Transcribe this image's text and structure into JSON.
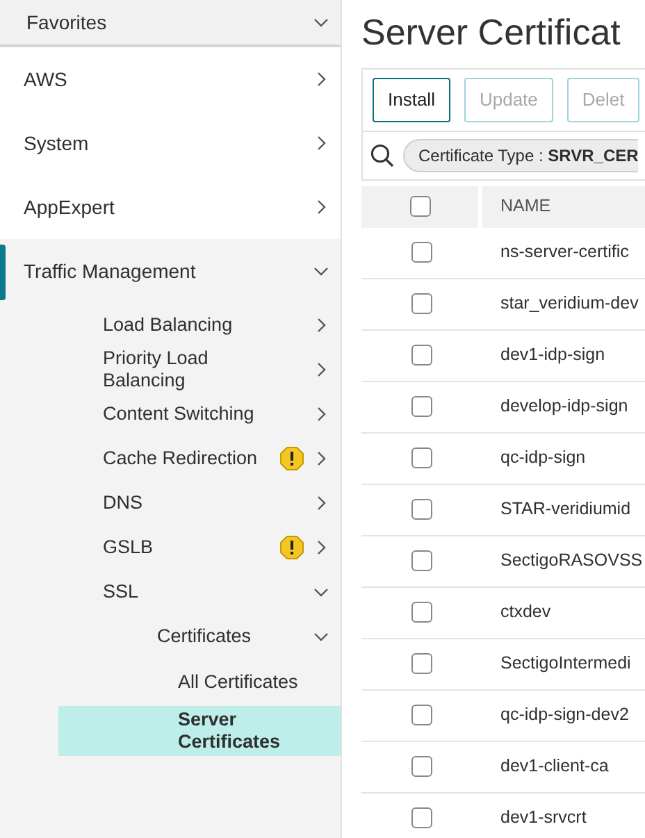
{
  "sidebar": {
    "favorites": {
      "label": "Favorites",
      "expanded": true
    },
    "items": [
      {
        "label": "AWS",
        "expanded": false,
        "active": false
      },
      {
        "label": "System",
        "expanded": false,
        "active": false
      },
      {
        "label": "AppExpert",
        "expanded": false,
        "active": false
      },
      {
        "label": "Traffic Management",
        "expanded": true,
        "active": true,
        "children": [
          {
            "label": "Load Balancing",
            "expanded": false,
            "warning": false
          },
          {
            "label": "Priority Load Balancing",
            "expanded": false,
            "warning": false
          },
          {
            "label": "Content Switching",
            "expanded": false,
            "warning": false
          },
          {
            "label": "Cache Redirection",
            "expanded": false,
            "warning": true
          },
          {
            "label": "DNS",
            "expanded": false,
            "warning": false
          },
          {
            "label": "GSLB",
            "expanded": false,
            "warning": true
          },
          {
            "label": "SSL",
            "expanded": true,
            "warning": false,
            "children": [
              {
                "label": "Certificates",
                "expanded": true,
                "warning": false,
                "children": [
                  {
                    "label": "All Certificates",
                    "selected": false
                  },
                  {
                    "label": "Server Certificates",
                    "selected": true
                  }
                ]
              }
            ]
          }
        ]
      }
    ]
  },
  "page": {
    "title": "Server Certificat",
    "buttons": [
      {
        "label": "Install",
        "disabled": false
      },
      {
        "label": "Update",
        "disabled": true
      },
      {
        "label": "Delet",
        "disabled": true
      }
    ],
    "filter": {
      "name": "Certificate Type : ",
      "value": "SRVR_CER"
    },
    "table": {
      "header_checked": false,
      "columns": [
        "NAME"
      ],
      "rows": [
        {
          "name": "ns-server-certific",
          "checked": false
        },
        {
          "name": "star_veridium-dev",
          "checked": false
        },
        {
          "name": "dev1-idp-sign",
          "checked": false
        },
        {
          "name": "develop-idp-sign",
          "checked": false
        },
        {
          "name": "qc-idp-sign",
          "checked": false
        },
        {
          "name": "STAR-veridiumid",
          "checked": false
        },
        {
          "name": "SectigoRASOVSS",
          "checked": false
        },
        {
          "name": "ctxdev",
          "checked": false
        },
        {
          "name": "SectigoIntermedi",
          "checked": false
        },
        {
          "name": "qc-idp-sign-dev2",
          "checked": false
        },
        {
          "name": "dev1-client-ca",
          "checked": false
        },
        {
          "name": "dev1-srvcrt",
          "checked": false
        }
      ]
    }
  }
}
